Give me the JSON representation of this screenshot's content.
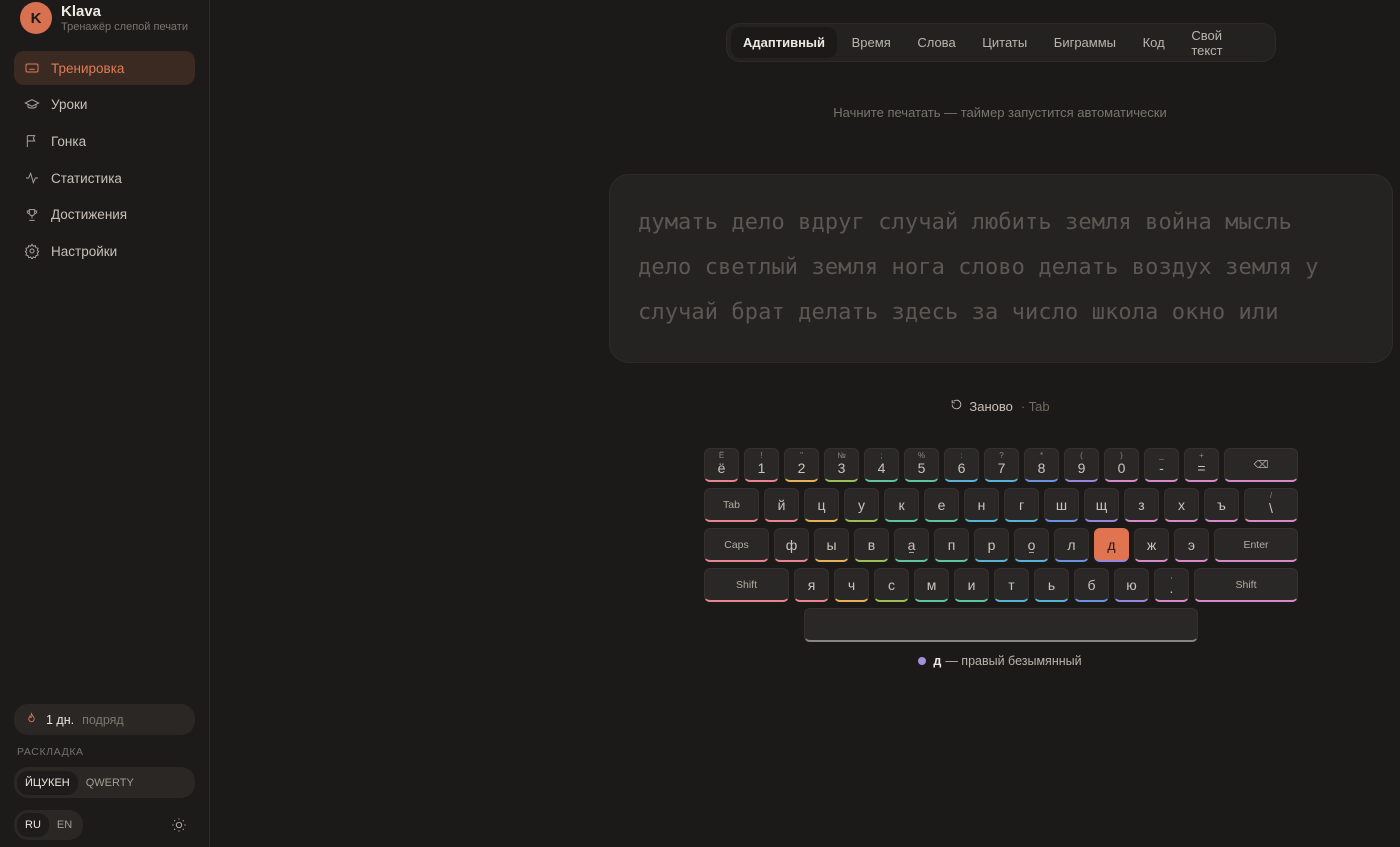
{
  "brand": {
    "avatar": "K",
    "name": "Klava",
    "subtitle": "Тренажёр слепой печати"
  },
  "nav": [
    {
      "label": "Тренировка",
      "icon": "keyboard-icon",
      "active": true
    },
    {
      "label": "Уроки",
      "icon": "graduation-cap-icon",
      "active": false
    },
    {
      "label": "Гонка",
      "icon": "flag-icon",
      "active": false
    },
    {
      "label": "Статистика",
      "icon": "activity-icon",
      "active": false
    },
    {
      "label": "Достижения",
      "icon": "trophy-icon",
      "active": false
    },
    {
      "label": "Настройки",
      "icon": "gear-icon",
      "active": false
    }
  ],
  "streak": {
    "count": "1 дн.",
    "label": "подряд"
  },
  "layout": {
    "title": "РАСКЛАДКА",
    "options": [
      "ЙЦУКЕН",
      "QWERTY"
    ],
    "selected": "ЙЦУКЕН"
  },
  "lang": {
    "options": [
      "RU",
      "EN"
    ],
    "selected": "RU"
  },
  "tabs": [
    {
      "label": "Адаптивный",
      "active": true
    },
    {
      "label": "Время",
      "active": false
    },
    {
      "label": "Слова",
      "active": false
    },
    {
      "label": "Цитаты",
      "active": false
    },
    {
      "label": "Биграммы",
      "active": false
    },
    {
      "label": "Код",
      "active": false
    },
    {
      "label": "Свой текст",
      "active": false
    }
  ],
  "hint": "Начните печатать — таймер запустится автоматически",
  "text_lines": [
    "думать дело вдруг случай любить земля война мысль",
    "дело светлый земля нога слово делать воздух земля у",
    "случай брат делать здесь за число школа окно или"
  ],
  "restart": {
    "label": "Заново",
    "shortcut": "· Tab"
  },
  "finger_colors": {
    "pinky": "#e8848f",
    "ring": "#e6b15a",
    "middle": "#9bbf5a",
    "index_left": "#5fc49b",
    "index_right": "#5ab3d6",
    "r_middle": "#6a92e0",
    "r_ring": "#9a86d8",
    "r_pinky": "#d889c9"
  },
  "keyboard": {
    "rows": [
      [
        {
          "main": "ё",
          "shift": "Ё",
          "finger": "pinky"
        },
        {
          "main": "1",
          "shift": "!",
          "finger": "pinky"
        },
        {
          "main": "2",
          "shift": "\"",
          "finger": "ring"
        },
        {
          "main": "3",
          "shift": "№",
          "finger": "middle"
        },
        {
          "main": "4",
          "shift": ";",
          "finger": "index_left"
        },
        {
          "main": "5",
          "shift": "%",
          "finger": "index_left"
        },
        {
          "main": "6",
          "shift": ":",
          "finger": "index_right"
        },
        {
          "main": "7",
          "shift": "?",
          "finger": "index_right"
        },
        {
          "main": "8",
          "shift": "*",
          "finger": "r_middle"
        },
        {
          "main": "9",
          "shift": "(",
          "finger": "r_ring"
        },
        {
          "main": "0",
          "shift": ")",
          "finger": "r_pinky"
        },
        {
          "main": "-",
          "shift": "_",
          "finger": "r_pinky"
        },
        {
          "main": "=",
          "shift": "+",
          "finger": "r_pinky"
        },
        {
          "main": "⌫",
          "shift": "",
          "finger": "r_pinky",
          "mod": true,
          "w": 74
        }
      ],
      [
        {
          "main": "Tab",
          "shift": "",
          "finger": "pinky",
          "mod": true,
          "w": 55
        },
        {
          "main": "й",
          "shift": "",
          "finger": "pinky"
        },
        {
          "main": "ц",
          "shift": "",
          "finger": "ring"
        },
        {
          "main": "у",
          "shift": "",
          "finger": "middle"
        },
        {
          "main": "к",
          "shift": "",
          "finger": "index_left"
        },
        {
          "main": "е",
          "shift": "",
          "finger": "index_left"
        },
        {
          "main": "н",
          "shift": "",
          "finger": "index_right"
        },
        {
          "main": "г",
          "shift": "",
          "finger": "index_right"
        },
        {
          "main": "ш",
          "shift": "",
          "finger": "r_middle"
        },
        {
          "main": "щ",
          "shift": "",
          "finger": "r_ring"
        },
        {
          "main": "з",
          "shift": "",
          "finger": "r_pinky"
        },
        {
          "main": "х",
          "shift": "",
          "finger": "r_pinky"
        },
        {
          "main": "ъ",
          "shift": "",
          "finger": "r_pinky"
        },
        {
          "main": "\\",
          "shift": "/",
          "finger": "r_pinky",
          "w": 54
        }
      ],
      [
        {
          "main": "Caps",
          "shift": "",
          "finger": "pinky",
          "mod": true,
          "w": 65
        },
        {
          "main": "ф",
          "shift": "",
          "finger": "pinky"
        },
        {
          "main": "ы",
          "shift": "",
          "finger": "ring"
        },
        {
          "main": "в",
          "shift": "",
          "finger": "middle"
        },
        {
          "main": "а",
          "shift": "",
          "finger": "index_left",
          "bump": true
        },
        {
          "main": "п",
          "shift": "",
          "finger": "index_left"
        },
        {
          "main": "р",
          "shift": "",
          "finger": "index_right"
        },
        {
          "main": "о",
          "shift": "",
          "finger": "index_right",
          "bump": true
        },
        {
          "main": "л",
          "shift": "",
          "finger": "r_middle"
        },
        {
          "main": "д",
          "shift": "",
          "finger": "r_ring",
          "highlight": true
        },
        {
          "main": "ж",
          "shift": "",
          "finger": "r_pinky"
        },
        {
          "main": "э",
          "shift": "",
          "finger": "r_pinky"
        },
        {
          "main": "Enter",
          "shift": "",
          "finger": "r_pinky",
          "mod": true,
          "w": 84
        }
      ],
      [
        {
          "main": "Shift",
          "shift": "",
          "finger": "pinky",
          "mod": true,
          "w": 85
        },
        {
          "main": "я",
          "shift": "",
          "finger": "pinky"
        },
        {
          "main": "ч",
          "shift": "",
          "finger": "ring"
        },
        {
          "main": "с",
          "shift": "",
          "finger": "middle"
        },
        {
          "main": "м",
          "shift": "",
          "finger": "index_left"
        },
        {
          "main": "и",
          "shift": "",
          "finger": "index_left"
        },
        {
          "main": "т",
          "shift": "",
          "finger": "index_right"
        },
        {
          "main": "ь",
          "shift": "",
          "finger": "index_right"
        },
        {
          "main": "б",
          "shift": "",
          "finger": "r_middle"
        },
        {
          "main": "ю",
          "shift": "",
          "finger": "r_ring"
        },
        {
          "main": ".",
          "shift": ",",
          "finger": "r_pinky"
        },
        {
          "main": "Shift",
          "shift": "",
          "finger": "r_pinky",
          "mod": true,
          "w": 104
        }
      ]
    ]
  },
  "finger_info": {
    "key": "д",
    "text": "— правый безымянный"
  }
}
